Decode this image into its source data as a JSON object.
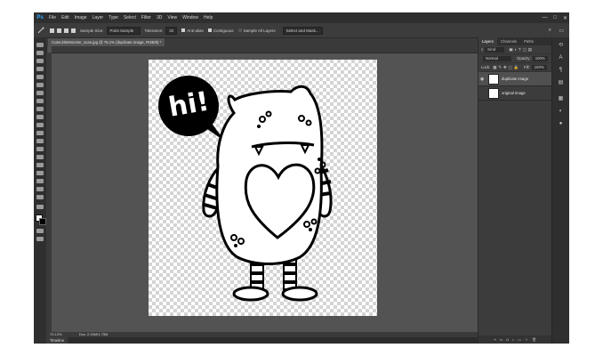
{
  "app": {
    "logo": "Ps",
    "menus": [
      "File",
      "Edit",
      "Image",
      "Layer",
      "Type",
      "Select",
      "Filter",
      "3D",
      "View",
      "Window",
      "Help"
    ],
    "window_controls": [
      "—",
      "□",
      "✕"
    ]
  },
  "options_bar": {
    "sample_size_label": "Sample Size:",
    "sample_size_value": "Point Sample",
    "tolerance_label": "Tolerance:",
    "tolerance_value": "32",
    "anti_alias": "Anti-alias",
    "contiguous": "Contiguous",
    "sample_all_layers": "Sample All Layers",
    "select_and_mask": "Select and Mask..."
  },
  "document": {
    "tab_label": "CuteLittleMonster_scan.jpg @ 75.1% (duplicate image, RGB/8) *",
    "speech_text": "hi!"
  },
  "status": {
    "zoom": "75.13%",
    "doc_size": "Doc: 2.00M/1.75M"
  },
  "timeline": {
    "label": "Timeline"
  },
  "layers_panel": {
    "tabs": [
      "Layers",
      "Channels",
      "Paths"
    ],
    "filter_kind": "Kind",
    "blend_mode": "Normal",
    "opacity_label": "Opacity:",
    "opacity_value": "100%",
    "lock_label": "Lock:",
    "fill_label": "Fill:",
    "fill_value": "100%",
    "layers": [
      {
        "name": "duplicate image",
        "visible": true,
        "selected": true
      },
      {
        "name": "original image",
        "visible": false,
        "selected": false
      }
    ]
  },
  "colors": {
    "menubar": "#2f2f2f",
    "workspace": "#535353",
    "panel": "#3c3c3c",
    "ps_blue": "#31a8ff"
  }
}
